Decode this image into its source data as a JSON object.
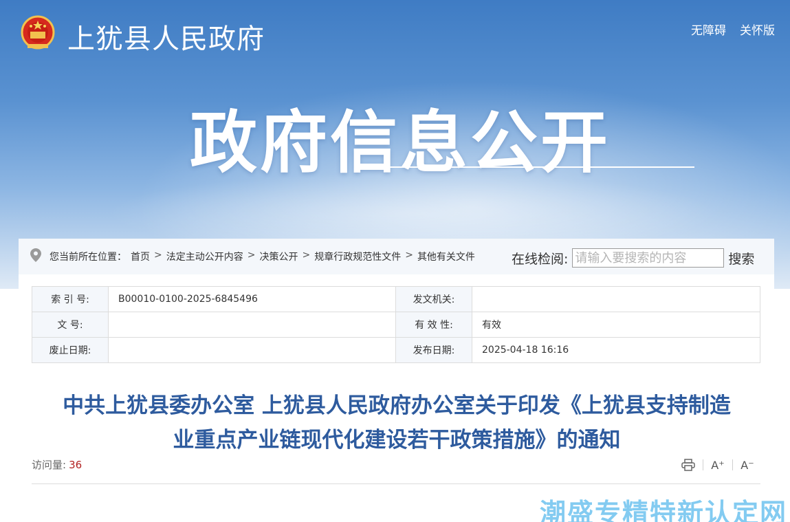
{
  "header": {
    "site_name": "上犹县人民政府",
    "links": [
      "无障碍",
      "关怀版"
    ],
    "hero_title": "政府信息公开"
  },
  "breadcrumb": {
    "prefix": "您当前所在位置：",
    "items": [
      "首页",
      "法定主动公开内容",
      "决策公开",
      "规章行政规范性文件",
      "其他有关文件"
    ],
    "separator": ">"
  },
  "search": {
    "label": "在线检阅:",
    "placeholder": "请输入要搜索的内容",
    "button": "搜索"
  },
  "meta": {
    "index_label": "索 引 号:",
    "index_value": "B00010-0100-2025-6845496",
    "issuer_label": "发文机关:",
    "issuer_value": "",
    "doc_no_label": "文    号:",
    "doc_no_value": "",
    "validity_label": "有 效 性:",
    "validity_value": "有效",
    "expiry_label": "废止日期:",
    "expiry_value": "",
    "publish_label": "发布日期:",
    "publish_value": "2025-04-18 16:16"
  },
  "article": {
    "title_line1": "中共上犹县委办公室 上犹县人民政府办公室关于印发《上犹县支持制造",
    "title_line2": "业重点产业链现代化建设若干政策措施》的通知",
    "visits_label": "访问量:",
    "visits_value": "36"
  },
  "tools": {
    "print_icon": "print-icon",
    "font_larger": "A⁺",
    "font_smaller": "A⁻"
  },
  "watermark": "潮盛专精特新认定网",
  "colors": {
    "title_blue": "#2e5b9e",
    "visits_red": "#b22222",
    "watermark": "#1ea0e6"
  }
}
